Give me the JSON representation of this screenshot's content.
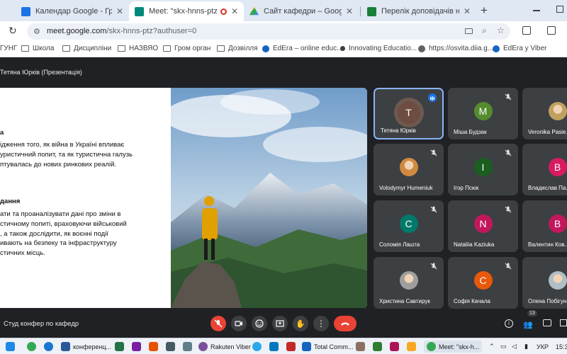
{
  "tabs": [
    {
      "title": "Календар Google - Графік по...",
      "color": "#1a73e8",
      "active": false
    },
    {
      "title": "Meet: \"skx-hnns-ptz\"",
      "color": "#00897b",
      "active": true
    },
    {
      "title": "Сайт кафедри – Google Диск",
      "color": "#fbbc04",
      "active": false
    },
    {
      "title": "Перелік доповідачів на студ к...",
      "color": "#188038",
      "active": false
    }
  ],
  "address": {
    "url_host": "meet.google.com",
    "url_path": "/skx-hnns-ptz?authuser=0"
  },
  "bookmarks": [
    "ГУНГ",
    "Школа",
    "Дисципліни",
    "НАЗВЯО",
    "Гром орган",
    "Дозвілля",
    "EdEra – online educ...",
    "Innovating Educatio...",
    "https://osvita.diia.g...",
    "EdEra у Viber"
  ],
  "presenter_label": "Тетяна Юрків (Презентація)",
  "slide": {
    "heading1": "а",
    "para1": [
      "ідження того, як війна в Україні впливає",
      "уристичний попит, та як туристична галузь",
      "птувалась до нових ринкових реалій."
    ],
    "heading2": "дання",
    "para2": [
      "ати та проаналізувати дані про зміни в",
      "стичному попиті, враховуючи військовий",
      ", а також дослідити, як воєнні події",
      "ивають на безпеку та інфраструктуру",
      "стичних місць."
    ]
  },
  "participants": [
    {
      "name": "Тетяна Юрків",
      "initial": "T",
      "color": "#6d4c41",
      "photo": false,
      "speaking": true
    },
    {
      "name": "Міша Будзак",
      "initial": "M",
      "color": "#558b2f",
      "photo": false,
      "speaking": false
    },
    {
      "name": "Veronika Pasie...",
      "initial": "V",
      "color": "#c0a060",
      "photo": true,
      "speaking": false
    },
    {
      "name": "Volodymyr Humeniuk",
      "initial": "V",
      "color": "#d08a40",
      "photo": true,
      "speaking": false
    },
    {
      "name": "Ігор Псюк",
      "initial": "I",
      "color": "#1b5e20",
      "photo": false,
      "speaking": false
    },
    {
      "name": "Владислав Па...",
      "initial": "B",
      "color": "#d81b60",
      "photo": false,
      "speaking": false
    },
    {
      "name": "Соломія Лашта",
      "initial": "C",
      "color": "#00796b",
      "photo": false,
      "speaking": false
    },
    {
      "name": "Nataliia Kaziuka",
      "initial": "N",
      "color": "#c2185b",
      "photo": false,
      "speaking": false
    },
    {
      "name": "Валентин Ков...",
      "initial": "B",
      "color": "#c2185b",
      "photo": false,
      "speaking": false
    },
    {
      "name": "Христина Савтирук",
      "initial": "X",
      "color": "#9e9e9e",
      "photo": true,
      "speaking": false
    },
    {
      "name": "Софія Качала",
      "initial": "C",
      "color": "#e8590c",
      "photo": false,
      "speaking": false
    },
    {
      "name": "Олена Побігун",
      "initial": "O",
      "color": "#b0bec5",
      "photo": true,
      "speaking": false
    }
  ],
  "meeting_name": "Студ конфер по кафедр",
  "people_count": "13",
  "taskbar": {
    "items": [
      "конференц...",
      "Rakuten Viber",
      "Total Comm...",
      "Meet: \"skx-h..."
    ],
    "lang": "УКР",
    "time": "15:3"
  }
}
